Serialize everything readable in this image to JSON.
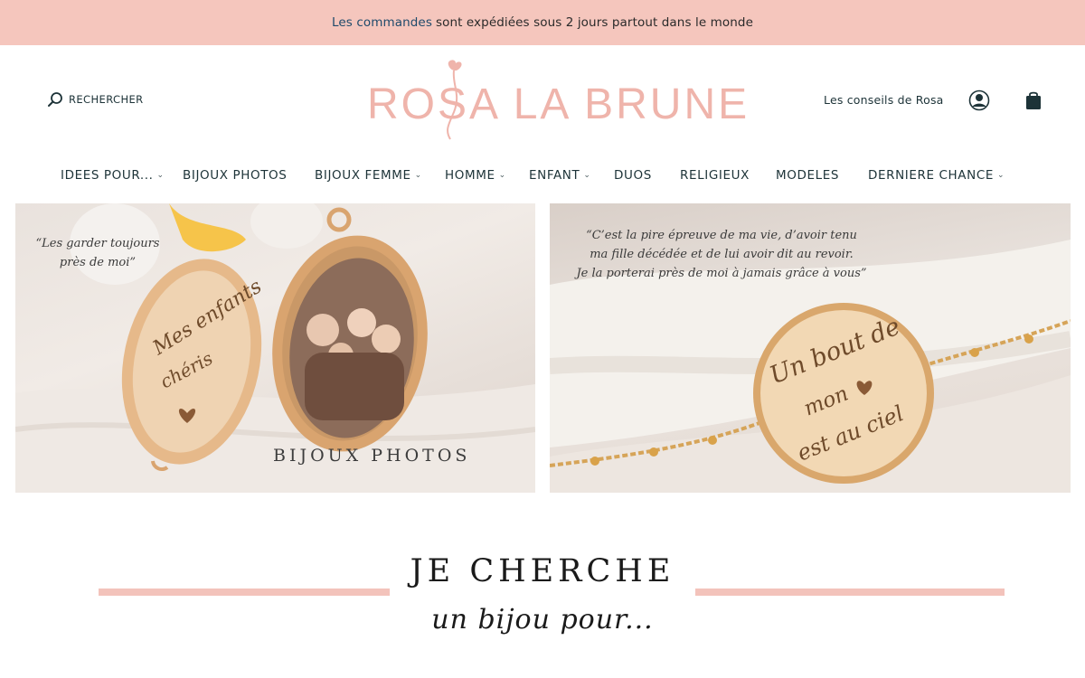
{
  "announcement": {
    "link_text": "Les commandes",
    "text": "sont expédiées sous 2 jours partout dans le monde"
  },
  "header": {
    "search_label": "RECHERCHER",
    "logo_text": "ROSA LA BRUNE",
    "conseils_link": "Les conseils de Rosa",
    "account_icon": "account-icon",
    "cart_icon": "shopping-bag-icon"
  },
  "nav": {
    "items": [
      {
        "label": "IDEES POUR...",
        "has_dropdown": true
      },
      {
        "label": "BIJOUX PHOTOS",
        "has_dropdown": false
      },
      {
        "label": "BIJOUX FEMME",
        "has_dropdown": true
      },
      {
        "label": "HOMME",
        "has_dropdown": true
      },
      {
        "label": "ENFANT",
        "has_dropdown": true
      },
      {
        "label": "DUOS",
        "has_dropdown": false
      },
      {
        "label": "RELIGIEUX",
        "has_dropdown": false
      },
      {
        "label": "MODELES",
        "has_dropdown": false
      },
      {
        "label": "DERNIERE CHANCE",
        "has_dropdown": true
      }
    ]
  },
  "banners": {
    "left": {
      "quote_line1": "“Les garder toujours",
      "quote_line2": "près de moi”",
      "engraving_line1": "Mes enfants",
      "engraving_line2": "chéris",
      "caption": "BIJOUX PHOTOS"
    },
    "right": {
      "quote_line1": "“C’est la pire épreuve de ma vie, d’avoir tenu",
      "quote_line2": "ma fille décédée et de lui avoir dit au revoir.",
      "quote_line3": "Je la porterai près de moi à jamais grâce à vous”",
      "engraving_line1": "Un bout de",
      "engraving_line2": "mon",
      "engraving_line3": "est au ciel"
    }
  },
  "section": {
    "heading": "JE CHERCHE",
    "subheading": "un bijou pour..."
  },
  "colors": {
    "announcement_bg": "#f5c6bd",
    "logo": "#efb4ab",
    "accent_line": "#f3c3bb",
    "text_dark": "#1d3338"
  }
}
